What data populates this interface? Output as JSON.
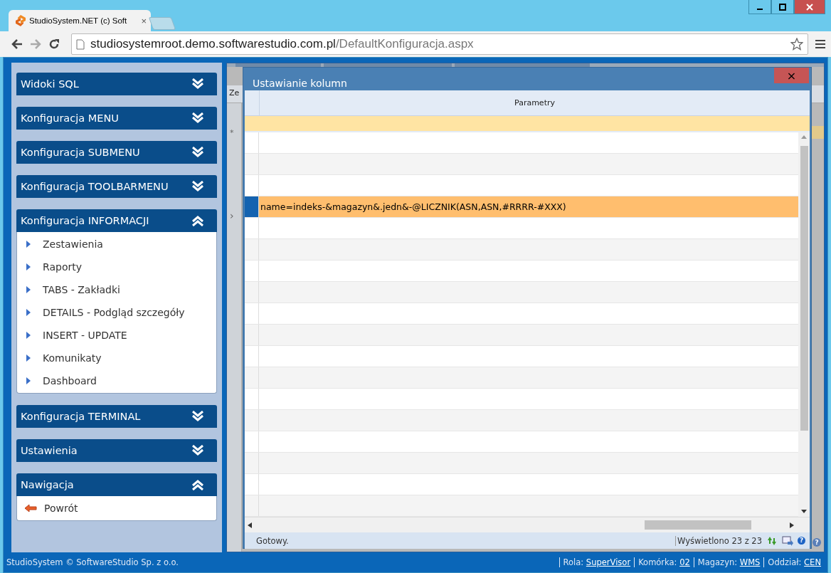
{
  "browser": {
    "tab": {
      "title": "StudioSystem.NET (c) Soft",
      "close_glyph": "×"
    },
    "url_host": "studiosystemroot.demo.softwarestudio.com.pl",
    "url_path": "/DefaultKonfiguracja.aspx"
  },
  "sidebar": {
    "panels": [
      {
        "title": "Widoki SQL",
        "expanded": false
      },
      {
        "title": "Konfiguracja MENU",
        "expanded": false
      },
      {
        "title": "Konfiguracja SUBMENU",
        "expanded": false
      },
      {
        "title": "Konfiguracja TOOLBARMENU",
        "expanded": false
      },
      {
        "title": "Konfiguracja INFORMACJI",
        "expanded": true,
        "items": [
          {
            "label": "Zestawienia",
            "kind": "link"
          },
          {
            "label": "Raporty",
            "kind": "link"
          },
          {
            "label": "TABS - Zakładki",
            "kind": "link"
          },
          {
            "label": "DETAILS - Podgląd szczegóły",
            "kind": "link"
          },
          {
            "label": "INSERT - UPDATE",
            "kind": "link"
          },
          {
            "label": "Komunikaty",
            "kind": "link"
          },
          {
            "label": "Dashboard",
            "kind": "link"
          }
        ]
      },
      {
        "title": "Konfiguracja TERMINAL",
        "expanded": false
      },
      {
        "title": "Ustawienia",
        "expanded": false
      },
      {
        "title": "Nawigacja",
        "expanded": true,
        "items": [
          {
            "label": "Powrót",
            "kind": "back"
          }
        ]
      }
    ]
  },
  "background_grid": {
    "header_text": "Ze",
    "row_marker": "*",
    "expand_glyph": "›",
    "help_glyph": "?"
  },
  "dialog": {
    "title": "Ustawianie kolumn",
    "close_glyph": "×",
    "column": "Parametry",
    "rows": [
      {
        "selected": false
      },
      {
        "selected": false
      },
      {
        "selected": false
      },
      {
        "selected": true,
        "text": "name=indeks-&magazyn&.jedn&-@LICZNIK(ASN,ASN,#RRRR-#XXX)"
      },
      {
        "selected": false
      },
      {
        "selected": false
      },
      {
        "selected": false
      },
      {
        "selected": false
      },
      {
        "selected": false
      },
      {
        "selected": false
      },
      {
        "selected": false
      },
      {
        "selected": false
      },
      {
        "selected": false
      },
      {
        "selected": false
      },
      {
        "selected": false
      },
      {
        "selected": false
      },
      {
        "selected": false
      },
      {
        "selected": false
      }
    ],
    "status": "Gotowy.",
    "count": "Wyświetlono 23 z 23",
    "help_glyph": "?"
  },
  "footer": {
    "copyright": "StudioSystem © SoftwareStudio Sp. z o.o.",
    "fields": [
      {
        "label": "Rola:",
        "value": "SuperVisor"
      },
      {
        "label": "Komórka:",
        "value": "02"
      },
      {
        "label": "Magazyn:",
        "value": "WMS"
      },
      {
        "label": "Oddział:",
        "value": "CEN"
      }
    ]
  }
}
